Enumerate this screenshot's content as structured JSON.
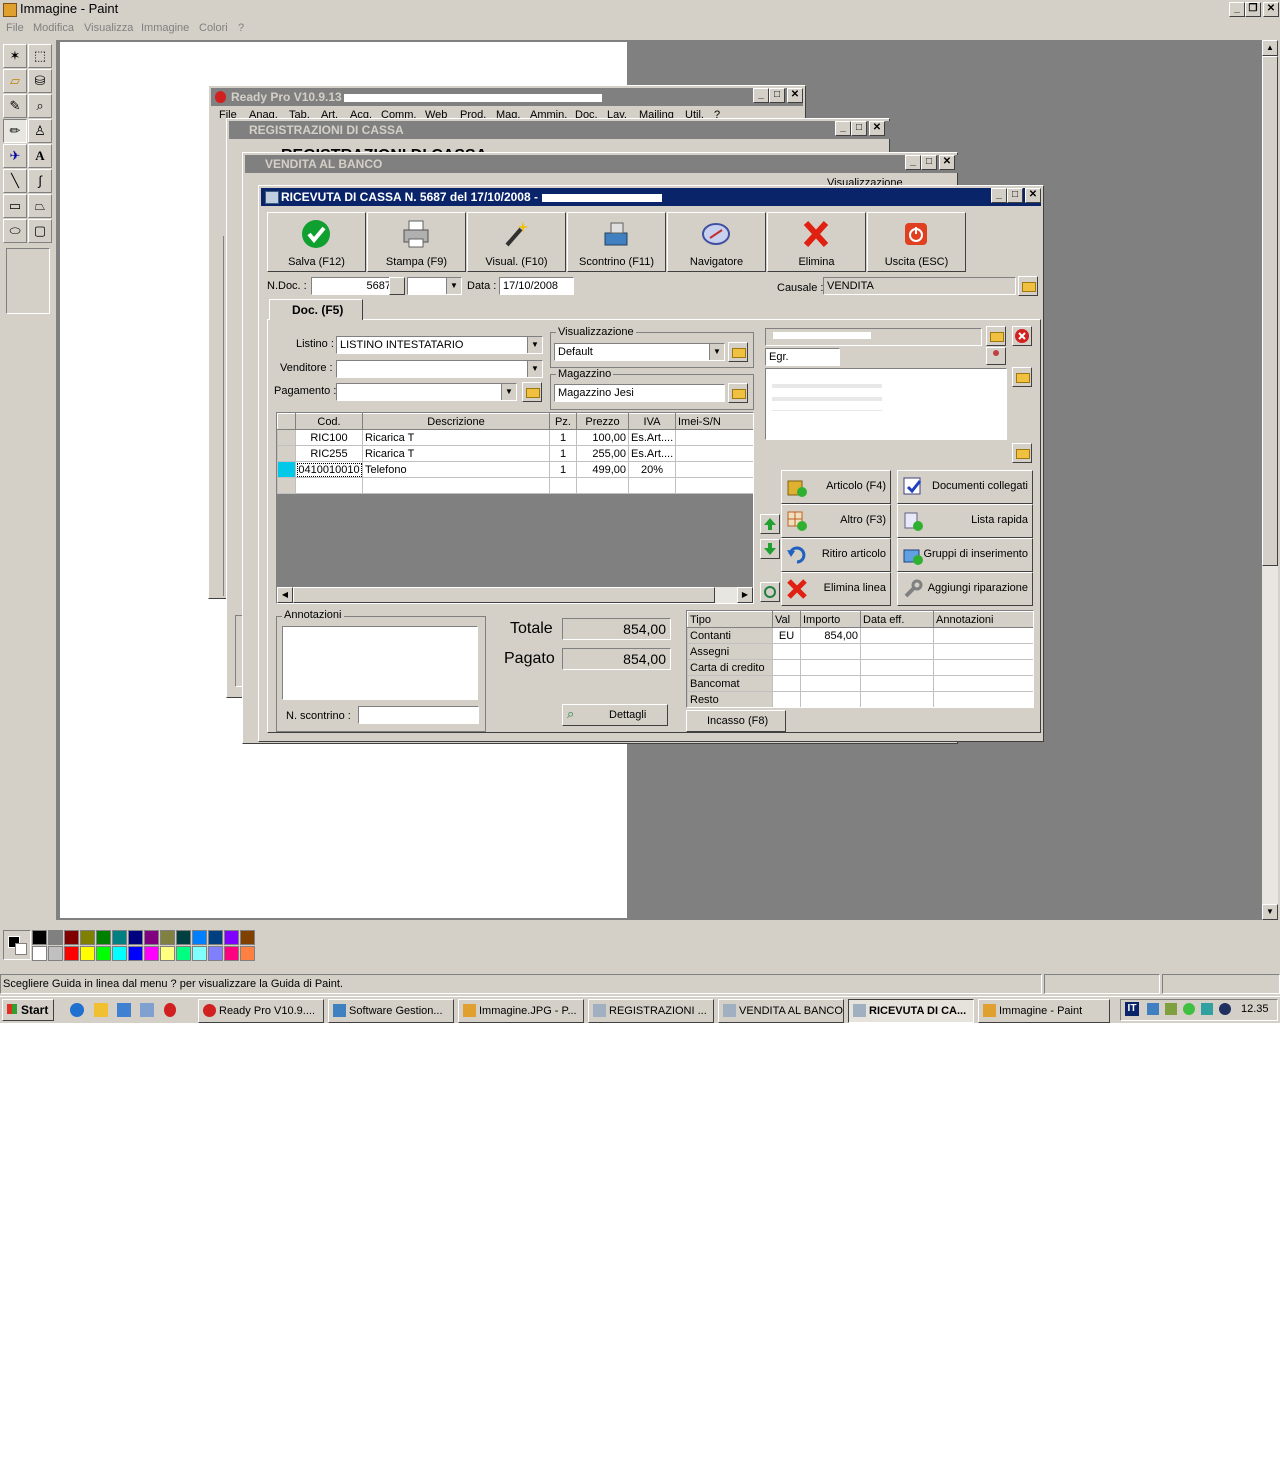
{
  "paint": {
    "title": "Immagine - Paint",
    "menu": [
      "File",
      "Modifica",
      "Visualizza",
      "Immagine",
      "Colori",
      "?"
    ],
    "status": "Scegliere Guida in linea dal menu ? per visualizzare la Guida di Paint.",
    "palette": [
      "#000000",
      "#808080",
      "#800000",
      "#808000",
      "#008000",
      "#008080",
      "#000080",
      "#800080",
      "#808040",
      "#004040",
      "#0080ff",
      "#004080",
      "#8000ff",
      "#804000",
      "#ffffff",
      "#c0c0c0",
      "#ff0000",
      "#ffff00",
      "#00ff00",
      "#00ffff",
      "#0000ff",
      "#ff00ff",
      "#ffff80",
      "#00ff80",
      "#80ffff",
      "#8080ff",
      "#ff0080",
      "#ff8040"
    ]
  },
  "readypro": {
    "title": "Ready Pro V10.9.13 -",
    "menu": [
      "File",
      "Anag.",
      "Tab.",
      "Art.",
      "Acq.",
      "Comm.",
      "Web",
      "Prod.",
      "Mag.",
      "Ammin.",
      "Doc.",
      "Lav.",
      "Mailing",
      "Util.",
      "?"
    ]
  },
  "registrazioni": {
    "title": "REGISTRAZIONI DI CASSA",
    "heading": "REGISTRAZIONI DI CASSA"
  },
  "vendita": {
    "title": "VENDITA AL BANCO",
    "label1": "Visualizzazione"
  },
  "ricevuta": {
    "title": "RICEVUTA DI CASSA N. 5687  del 17/10/2008 -",
    "toolbar": {
      "salva": "Salva (F12)",
      "stampa": "Stampa (F9)",
      "visual": "Visual. (F10)",
      "scontrino": "Scontrino (F11)",
      "navigatore": "Navigatore",
      "elimina": "Elimina",
      "uscita": "Uscita (ESC)"
    },
    "ndoc_label": "N.Doc. :",
    "ndoc_value": "5687",
    "data_label": "Data :",
    "data_value": "17/10/2008",
    "causale_label": "Causale :",
    "causale_value": "VENDITA",
    "tab": "Doc. (F5)",
    "listino_label": "Listino :",
    "listino_value": "LISTINO INTESTATARIO",
    "venditore_label": "Venditore :",
    "venditore_value": "",
    "pagamento_label": "Pagamento :",
    "pagamento_value": "",
    "visualizzazione_label": "Visualizzazione",
    "visualizzazione_value": "Default",
    "magazzino_label": "Magazzino",
    "magazzino_value": "Magazzino Jesi",
    "cliente_titolo": "Egr.",
    "grid": {
      "headers": [
        "Cod.",
        "Descrizione",
        "Pz.",
        "Prezzo",
        "IVA",
        "Imei-S/N"
      ],
      "rows": [
        [
          "RIC100",
          "Ricarica T",
          "1",
          "100,00",
          "Es.Art....",
          ""
        ],
        [
          "RIC255",
          "Ricarica T",
          "1",
          "255,00",
          "Es.Art....",
          ""
        ],
        [
          "0410010010",
          "Telefono",
          "1",
          "499,00",
          "20%",
          ""
        ]
      ]
    },
    "side_buttons": {
      "articolo": "Articolo (F4)",
      "documenti": "Documenti collegati",
      "altro": "Altro (F3)",
      "lista": "Lista rapida",
      "ritiro": "Ritiro articolo",
      "gruppi": "Gruppi di inserimento",
      "elimina_linea": "Elimina linea",
      "riparazione": "Aggiungi riparazione"
    },
    "annotazioni_label": "Annotazioni",
    "nscontrino_label": "N. scontrino :",
    "totale_label": "Totale",
    "totale_value": "854,00",
    "pagato_label": "Pagato",
    "pagato_value": "854,00",
    "dettagli": "Dettagli",
    "incasso": "Incasso (F8)",
    "payments": {
      "headers": [
        "Tipo",
        "Val",
        "Importo",
        "Data eff.",
        "Annotazioni"
      ],
      "rows": [
        [
          "Contanti",
          "EU",
          "854,00",
          "",
          ""
        ],
        [
          "Assegni",
          "",
          "",
          "",
          ""
        ],
        [
          "Carta di credito",
          "",
          "",
          "",
          ""
        ],
        [
          "Bancomat",
          "",
          "",
          "",
          ""
        ],
        [
          "Resto",
          "",
          "",
          "",
          ""
        ]
      ]
    }
  },
  "taskbar": {
    "start": "Start",
    "items": [
      "Ready Pro V10.9....",
      "Software Gestion...",
      "Immagine.JPG - P...",
      "REGISTRAZIONI ...",
      "VENDITA AL BANCO",
      "RICEVUTA DI CA...",
      "Immagine - Paint"
    ],
    "lang": "IT",
    "clock": "12.35"
  }
}
